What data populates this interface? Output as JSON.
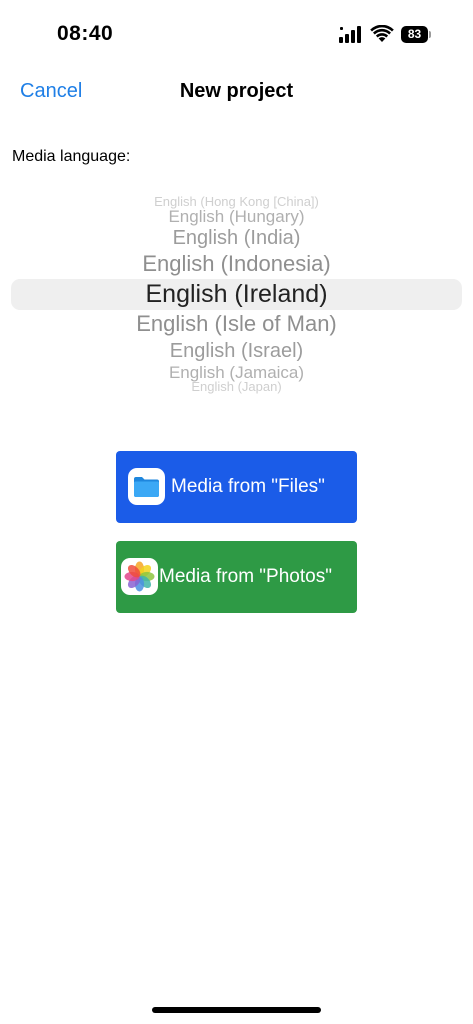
{
  "status_bar": {
    "time": "08:40",
    "battery_level": "83",
    "icons": [
      "cellular-signal-icon",
      "wifi-icon",
      "battery-icon"
    ]
  },
  "nav": {
    "cancel_label": "Cancel",
    "title": "New project"
  },
  "media_language": {
    "label": "Media language:",
    "options": [
      "",
      "English (Hong Kong [China])",
      "English (Hungary)",
      "English (India)",
      "English (Indonesia)",
      "English (Ireland)",
      "English (Isle of Man)",
      "English (Israel)",
      "English (Jamaica)",
      "English (Japan)"
    ],
    "selected": "English (Ireland)"
  },
  "buttons": {
    "files_label": "Media from \"Files\"",
    "photos_label": "Media from \"Photos\""
  },
  "colors": {
    "accent": "#1f7fe6",
    "files_button": "#1b5ce8",
    "photos_button": "#2e9a45"
  }
}
